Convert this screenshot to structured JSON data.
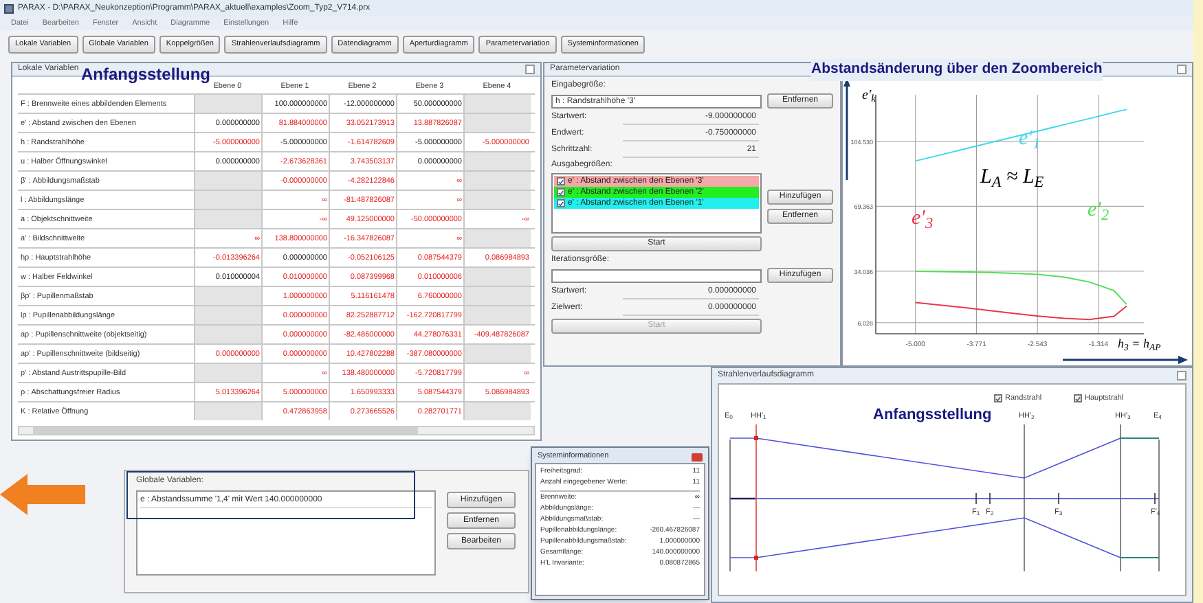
{
  "window": {
    "title": "PARAX - D:\\PARAX_Neukonzeption\\Programm\\PARAX_aktuell\\examples\\Zoom_Typ2_V714.prx"
  },
  "menu": [
    "Datei",
    "Bearbeiten",
    "Fenster",
    "Ansicht",
    "Diagramme",
    "Einstellungen",
    "Hilfe"
  ],
  "toolbar": [
    "Lokale Variablen",
    "Globale Variablen",
    "Koppelgrößen",
    "Strahlenverlaufsdiagramm",
    "Datendiagramm",
    "Aperturdiagramm",
    "Parametervariation",
    "Systeminformationen"
  ],
  "local_variables": {
    "title": "Lokale Variablen",
    "annotation": "Anfangsstellung",
    "columns": [
      "Ebene 0",
      "Ebene 1",
      "Ebene 2",
      "Ebene 3",
      "Ebene 4"
    ],
    "rows": [
      {
        "name": "F : Brennweite eines abbildenden Elements",
        "cells": [
          null,
          {
            "value": "100.000000000",
            "red": false
          },
          {
            "value": "-12.000000000",
            "red": false
          },
          {
            "value": "50.000000000",
            "red": false
          },
          null
        ]
      },
      {
        "name": "e' : Abstand zwischen den Ebenen",
        "cells": [
          {
            "value": "0.000000000",
            "red": false
          },
          {
            "value": "81.884000000",
            "red": true
          },
          {
            "value": "33.052173913",
            "red": true
          },
          {
            "value": "13.887826087",
            "red": true
          },
          null
        ]
      },
      {
        "name": "h : Randstrahlhöhe",
        "cells": [
          {
            "value": "-5.000000000",
            "red": true
          },
          {
            "value": "-5.000000000",
            "red": false
          },
          {
            "value": "-1.614782609",
            "red": true
          },
          {
            "value": "-5.000000000",
            "red": false
          },
          {
            "value": "-5.000000000",
            "red": true
          }
        ]
      },
      {
        "name": "u : Halber Öffnungswinkel",
        "cells": [
          {
            "value": "0.000000000",
            "red": false
          },
          {
            "value": "-2.673628361",
            "red": true
          },
          {
            "value": "3.743503137",
            "red": true
          },
          {
            "value": "0.000000000",
            "red": false
          },
          null
        ]
      },
      {
        "name": "β' : Abbildungsmaßstab",
        "cells": [
          null,
          {
            "value": "-0.000000000",
            "red": true
          },
          {
            "value": "-4.282122846",
            "red": true
          },
          {
            "value": "∞",
            "red": true
          },
          null
        ]
      },
      {
        "name": "l : Abbildungslänge",
        "cells": [
          null,
          {
            "value": "∞",
            "red": true
          },
          {
            "value": "-81.487826087",
            "red": true
          },
          {
            "value": "∞",
            "red": true
          },
          null
        ]
      },
      {
        "name": "a : Objektschnittweite",
        "cells": [
          null,
          {
            "value": "-∞",
            "red": true
          },
          {
            "value": "49.125000000",
            "red": true
          },
          {
            "value": "-50.000000000",
            "red": true
          },
          {
            "value": "-∞",
            "red": true
          }
        ]
      },
      {
        "name": "a' : Bildschnittweite",
        "cells": [
          {
            "value": "∞",
            "red": true
          },
          {
            "value": "138.800000000",
            "red": true
          },
          {
            "value": "-16.347826087",
            "red": true
          },
          {
            "value": "∞",
            "red": true
          },
          null
        ]
      },
      {
        "name": "hp : Hauptstrahlhöhe",
        "cells": [
          {
            "value": "-0.013396264",
            "red": true
          },
          {
            "value": "0.000000000",
            "red": false
          },
          {
            "value": "-0.052106125",
            "red": true
          },
          {
            "value": "0.087544379",
            "red": true
          },
          {
            "value": "0.086984893",
            "red": true
          }
        ]
      },
      {
        "name": "w : Halber Feldwinkel",
        "cells": [
          {
            "value": "0.010000004",
            "red": false
          },
          {
            "value": "0.010000000",
            "red": true
          },
          {
            "value": "0.087399968",
            "red": true
          },
          {
            "value": "0.010000006",
            "red": true
          },
          null
        ]
      },
      {
        "name": "βp' : Pupillenmaßstab",
        "cells": [
          null,
          {
            "value": "1.000000000",
            "red": true
          },
          {
            "value": "5.116161478",
            "red": true
          },
          {
            "value": "6.760000000",
            "red": true
          },
          null
        ]
      },
      {
        "name": "lp : Pupillenabbildungslänge",
        "cells": [
          null,
          {
            "value": "0.000000000",
            "red": true
          },
          {
            "value": "82.252887712",
            "red": true
          },
          {
            "value": "-162.720817799",
            "red": true
          },
          null
        ]
      },
      {
        "name": "ap : Pupillenschnittweite (objektseitig)",
        "cells": [
          null,
          {
            "value": "0.000000000",
            "red": true
          },
          {
            "value": "-82.486000000",
            "red": true
          },
          {
            "value": "44.278076331",
            "red": true
          },
          {
            "value": "-409.487826087",
            "red": true
          }
        ]
      },
      {
        "name": "ap' : Pupillenschnittweite (bildseitig)",
        "cells": [
          {
            "value": "0.000000000",
            "red": true
          },
          {
            "value": "0.000000000",
            "red": true
          },
          {
            "value": "10.427802288",
            "red": true
          },
          {
            "value": "-387.080000000",
            "red": true
          },
          null
        ]
      },
      {
        "name": "p' : Abstand Austrittspupille-Bild",
        "cells": [
          null,
          {
            "value": "∞",
            "red": true
          },
          {
            "value": "138.480000000",
            "red": true
          },
          {
            "value": "-5.720817799",
            "red": true
          },
          {
            "value": "∞",
            "red": true
          }
        ]
      },
      {
        "name": "ρ : Abschattungsfreier Radius",
        "cells": [
          {
            "value": "5.013396264",
            "red": true
          },
          {
            "value": "5.000000000",
            "red": true
          },
          {
            "value": "1.650993333",
            "red": true
          },
          {
            "value": "5.087544379",
            "red": true
          },
          {
            "value": "5.086984893",
            "red": true
          }
        ]
      },
      {
        "name": "K : Relative Öffnung",
        "cells": [
          null,
          {
            "value": "0.472863958",
            "red": true
          },
          {
            "value": "0.273665526",
            "red": true
          },
          {
            "value": "0.282701771",
            "red": true
          },
          null
        ]
      }
    ]
  },
  "parameter_variation": {
    "title": "Parametervariation",
    "input_label": "Eingabegröße:",
    "input_value": "h : Randstrahlhöhe '3'",
    "input_button": "Entfernen",
    "fields": [
      {
        "label": "Startwert:",
        "value": "-9.000000000"
      },
      {
        "label": "Endwert:",
        "value": "-0.750000000"
      },
      {
        "label": "Schrittzahl:",
        "value": "21"
      }
    ],
    "output_label": "Ausgabegrößen:",
    "outputs": [
      {
        "label": "e' : Abstand zwischen den Ebenen '3'",
        "checked": true,
        "color": "#f4a8a8"
      },
      {
        "label": "e' : Abstand zwischen den Ebenen '2'",
        "checked": true,
        "color": "#22ee22"
      },
      {
        "label": "e' : Abstand zwischen den Ebenen '1'",
        "checked": true,
        "color": "#22eeee"
      }
    ],
    "output_buttons": [
      "Hinzufügen",
      "Entfernen"
    ],
    "start": {
      "label": "Start",
      "disabled": false
    },
    "iteration_label": "Iterationsgröße:",
    "iteration_button": "Hinzufügen",
    "iteration_fields": [
      {
        "label": "Startwert:",
        "value": "0.000000000"
      },
      {
        "label": "Zielwert:",
        "value": "0.000000000"
      }
    ],
    "iteration_start": {
      "label": "Start",
      "disabled": true
    }
  },
  "chart_panel": {
    "annotation": "Abstandsänderung über den Zoombereich",
    "y_axis_label": "e′$_{k}$",
    "x_axis_label": "h$_{3}$ = h$_{AP}$",
    "formula": "L$_{A}$ ≈ L$_{E}$",
    "chart_data": {
      "type": "line",
      "grid": true,
      "x": [
        -5,
        -4.5,
        -4,
        -3.5,
        -3,
        -2.5,
        -2,
        -1.5,
        -1,
        -0.75
      ],
      "xlim": [
        -5.8,
        -0.4
      ],
      "ylim": [
        0,
        130
      ],
      "xticks": [
        {
          "value": -5,
          "label": "-5.000"
        },
        {
          "value": -3.771,
          "label": "-3.771"
        },
        {
          "value": -2.543,
          "label": "-2.543"
        },
        {
          "value": -1.314,
          "label": "-1.314"
        }
      ],
      "yticks": [
        {
          "value": 6.028,
          "label": "6.028"
        },
        {
          "value": 34.036,
          "label": "34.036"
        },
        {
          "value": 69.363,
          "label": "69.363"
        },
        {
          "value": 104.53,
          "label": "104.530"
        }
      ],
      "series": [
        {
          "name": "e′$_{1}$",
          "color": "#40d8e8",
          "values": [
            94,
            97.3,
            100.6,
            103.9,
            107.2,
            110.5,
            113.8,
            117.1,
            120.4,
            122
          ]
        },
        {
          "name": "e′$_{2}$",
          "color": "#55dd55",
          "values": [
            34,
            33.8,
            33.6,
            33.3,
            32.9,
            32.2,
            30.8,
            28.2,
            23.5,
            16
          ]
        },
        {
          "name": "e′$_{3}$",
          "color": "#e83848",
          "values": [
            17,
            15.6,
            14.2,
            12.6,
            11,
            9.6,
            8.4,
            7.8,
            9.5,
            15
          ]
        }
      ]
    }
  },
  "global_variables": {
    "label": "Globale Variablen:",
    "items": [
      "e : Abstandssumme '1,4' mit Wert 140.000000000"
    ],
    "buttons": [
      "Hinzufügen",
      "Entfernen",
      "Bearbeiten"
    ]
  },
  "system_info": {
    "title": "Systeminformationen",
    "groups": [
      [
        {
          "label": "Freiheitsgrad:",
          "value": "11"
        },
        {
          "label": "Anzahl eingegebener Werte:",
          "value": "11"
        }
      ],
      [
        {
          "label": "Brennweite:",
          "value": "∞"
        },
        {
          "label": "Abbildungslänge:",
          "value": "—"
        },
        {
          "label": "Abbildungsmaßstab:",
          "value": "—"
        },
        {
          "label": "Pupillenabbildungslänge:",
          "value": "-260.467826087"
        },
        {
          "label": "Pupillenabbildungsmaßstab:",
          "value": "1.000000000"
        },
        {
          "label": "Gesamtlänge:",
          "value": "140.000000000"
        },
        {
          "label": "H'L Invariante:",
          "value": "0.080872865"
        }
      ]
    ]
  },
  "ray_diagram": {
    "title": "Strahlenverlaufsdiagramm",
    "annotation": "Anfangsstellung",
    "checkboxes": [
      {
        "label": "Randstrahl",
        "checked": true
      },
      {
        "label": "Hauptstrahl",
        "checked": true
      }
    ],
    "top_labels": [
      "E$_{0}$",
      "HH′$_{1}$",
      "HH′$_{2}$",
      "HH′$_{3}$",
      "E$_{4}$"
    ],
    "bottom_labels": [
      "F$_{1}$",
      "F$_{2}$",
      "F$_{3}$",
      "F′$_{4}$"
    ]
  }
}
